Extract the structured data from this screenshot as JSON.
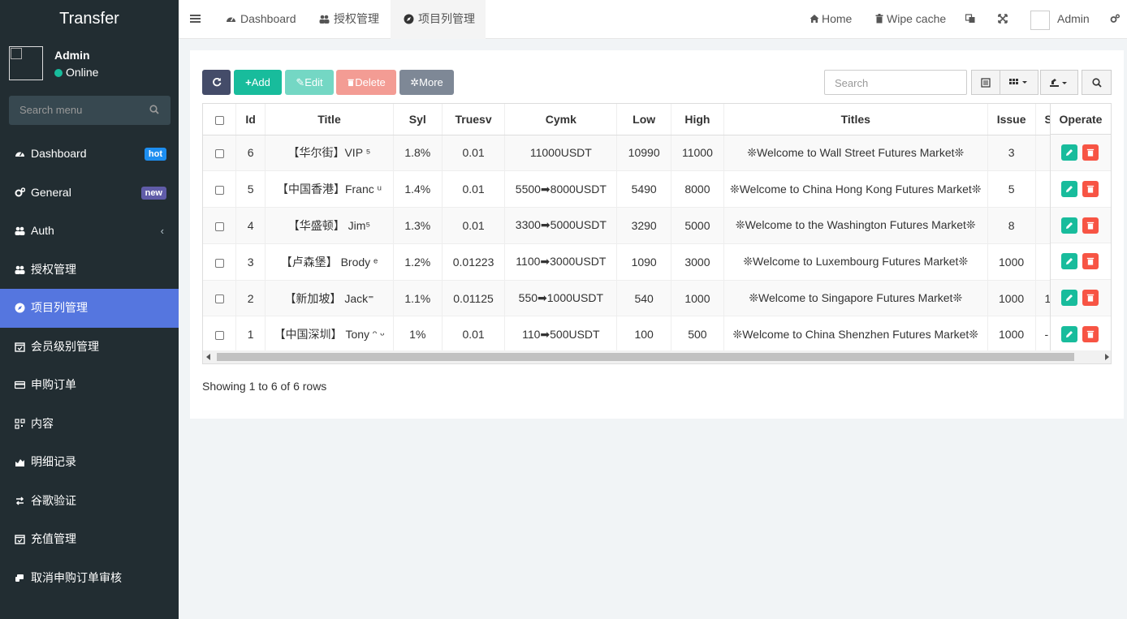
{
  "app": {
    "brand": "Transfer"
  },
  "user": {
    "name": "Admin",
    "status": "Online"
  },
  "sidebar": {
    "search_placeholder": "Search menu",
    "items": [
      {
        "label": "Dashboard",
        "icon": "dashboard-icon",
        "badge": "hot"
      },
      {
        "label": "General",
        "icon": "cogs-icon",
        "badge": "new"
      },
      {
        "label": "Auth",
        "icon": "users-icon",
        "chevron": "‹"
      },
      {
        "label": "授权管理",
        "icon": "users-icon"
      },
      {
        "label": "项目列管理",
        "icon": "compass-icon",
        "active": true
      },
      {
        "label": "会员级别管理",
        "icon": "calendar-check-icon"
      },
      {
        "label": "申购订单",
        "icon": "credit-card-icon"
      },
      {
        "label": "内容",
        "icon": "qrcode-icon"
      },
      {
        "label": "明细记录",
        "icon": "area-chart-icon"
      },
      {
        "label": "谷歌验证",
        "icon": "exchange-icon"
      },
      {
        "label": "充值管理",
        "icon": "calendar-check-icon"
      },
      {
        "label": "取消申购订单审核",
        "icon": "hand-icon"
      }
    ]
  },
  "header": {
    "tabs": [
      {
        "label": "Dashboard",
        "icon": "dashboard-icon"
      },
      {
        "label": "授权管理",
        "icon": "users-icon"
      },
      {
        "label": "项目列管理",
        "icon": "compass-icon",
        "active": true
      }
    ],
    "home": "Home",
    "wipe_cache": "Wipe cache",
    "admin": "Admin"
  },
  "toolbar": {
    "add": "Add",
    "edit": "Edit",
    "delete": "Delete",
    "more": "More",
    "search_placeholder": "Search"
  },
  "table": {
    "columns": [
      "Id",
      "Title",
      "Syl",
      "Truesv",
      "Cymk",
      "Low",
      "High",
      "Titles",
      "Issue",
      "S",
      "Operate"
    ],
    "rows": [
      {
        "id": "6",
        "title": "【华尔街】VIP ⁵",
        "syl": "1.8%",
        "truesv": "0.01",
        "cymk": "11000USDT",
        "low": "10990",
        "high": "11000",
        "titles": "❊Welcome to Wall Street Futures Market❊",
        "issue": "3",
        "s": ""
      },
      {
        "id": "5",
        "title": "【中国香港】Franc ᵘ",
        "syl": "1.4%",
        "truesv": "0.01",
        "cymk": "5500➡8000USDT",
        "low": "5490",
        "high": "8000",
        "titles": "❊Welcome to China Hong Kong Futures Market❊",
        "issue": "5",
        "s": ""
      },
      {
        "id": "4",
        "title": "【华盛顿】 Jim⁵",
        "syl": "1.3%",
        "truesv": "0.01",
        "cymk": "3300➡5000USDT",
        "low": "3290",
        "high": "5000",
        "titles": "❊Welcome to the Washington Futures Market❊",
        "issue": "8",
        "s": ""
      },
      {
        "id": "3",
        "title": "【卢森堡】 Brody ᵉ",
        "syl": "1.2%",
        "truesv": "0.01223",
        "cymk": "1100➡3000USDT",
        "low": "1090",
        "high": "3000",
        "titles": "❊Welcome to Luxembourg Futures Market❊",
        "issue": "1000",
        "s": ""
      },
      {
        "id": "2",
        "title": "【新加坡】 Jack⁼",
        "syl": "1.1%",
        "truesv": "0.01125",
        "cymk": "550➡1000USDT",
        "low": "540",
        "high": "1000",
        "titles": "❊Welcome to Singapore Futures Market❊",
        "issue": "1000",
        "s": "1"
      },
      {
        "id": "1",
        "title": "【中国深圳】 Tony ᵔ ᵕ",
        "syl": "1%",
        "truesv": "0.01",
        "cymk": "110➡500USDT",
        "low": "100",
        "high": "500",
        "titles": "❊Welcome to China Shenzhen Futures Market❊",
        "issue": "1000",
        "s": "-"
      }
    ]
  },
  "pagination": {
    "summary": "Showing 1 to 6 of 6 rows"
  },
  "colors": {
    "sidebar_bg": "#222d32",
    "active": "#5576df",
    "success": "#18bc9c",
    "danger": "#f75444"
  }
}
